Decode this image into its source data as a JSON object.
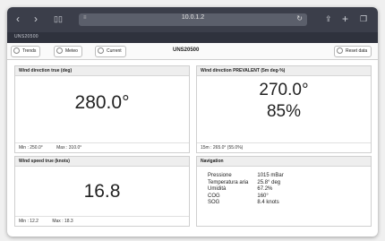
{
  "browser": {
    "url": "10.0.1.2",
    "tab_title": "UNS20500"
  },
  "appbar": {
    "trends_label": "Trends",
    "meteo_label": "Meteo",
    "current_label": "Current",
    "device_name": "UNS20500",
    "reset_label": "Reset data"
  },
  "panels": {
    "wind_dir": {
      "title": "Wind direction true (deg)",
      "value": "280.0°",
      "min": "Min : 250.0°",
      "max": "Max : 310.0°"
    },
    "wind_prev": {
      "title": "Wind direction PREVALENT (5m deg-%)",
      "value1": "270.0°",
      "value2": "85%",
      "footer": "15m : 265.0° (55.0%)"
    },
    "wind_speed": {
      "title": "Wind speed true (knots)",
      "value": "16.8",
      "min": "Min : 12.2",
      "max": "Max : 18.3"
    },
    "navigation": {
      "title": "Navigation",
      "rows": [
        {
          "label": "Pressione",
          "value": "1015 mBar"
        },
        {
          "label": "Temperatura aria",
          "value": "25.8° deg"
        },
        {
          "label": "Umidità",
          "value": "67.2%"
        },
        {
          "label": "COG",
          "value": "160°"
        },
        {
          "label": "SOG",
          "value": "8.4 knots"
        }
      ]
    }
  },
  "icons": [
    "back-icon",
    "forward-icon",
    "bookmarks-icon",
    "reader-icon",
    "reload-icon",
    "share-icon",
    "new-tab-icon",
    "tabs-icon",
    "trends-icon",
    "meteo-icon",
    "current-icon",
    "reset-icon"
  ]
}
